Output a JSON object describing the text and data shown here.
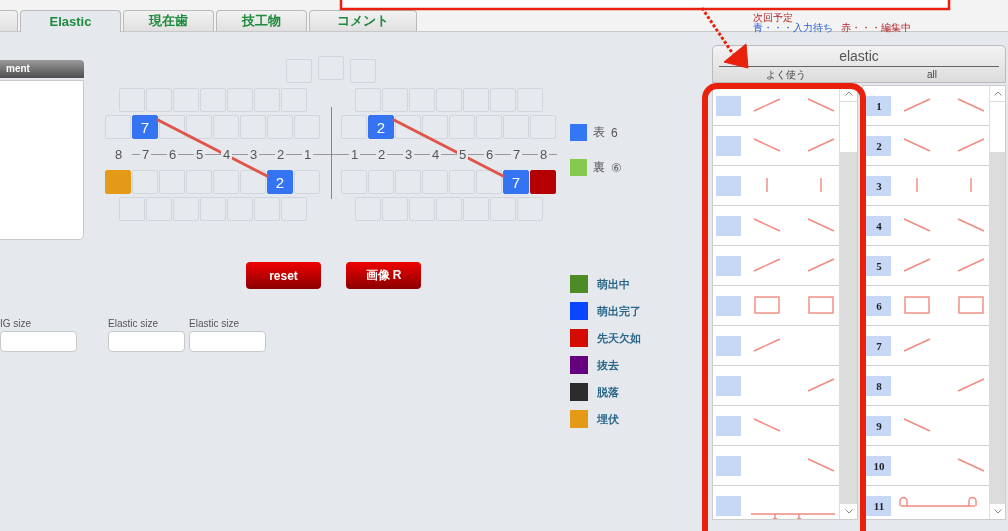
{
  "tabs": [
    {
      "selected": false
    },
    {
      "label": "Elastic",
      "selected": true
    },
    {
      "label": "現在歯",
      "selected": false
    },
    {
      "label": "技工物",
      "selected": false
    },
    {
      "label": "コメント",
      "selected": false
    }
  ],
  "schedule_note": {
    "title": "次回予定",
    "waiting": "青・・・入力待ち",
    "editing": "赤・・・編集中"
  },
  "comment_panel": {
    "title": "ment"
  },
  "chart": {
    "mini_row": [
      {
        "filled": false
      },
      {
        "filled": false
      },
      {
        "filled": false
      }
    ],
    "left": {
      "outer_upper": [
        {
          "filled": false
        },
        {
          "filled": false
        },
        {
          "filled": false
        },
        {
          "filled": false
        },
        {
          "filled": false
        },
        {
          "filled": false
        },
        {
          "filled": false
        }
      ],
      "upper": [
        {
          "filled": false
        },
        {
          "filled": true,
          "label": "7",
          "color": "#3474f2"
        },
        {
          "filled": false
        },
        {
          "filled": false
        },
        {
          "filled": false
        },
        {
          "filled": false
        },
        {
          "filled": false
        },
        {
          "filled": false
        }
      ],
      "numbers": [
        "8",
        "7",
        "6",
        "5",
        "4",
        "3",
        "2",
        "1"
      ],
      "lower": [
        {
          "filled": true,
          "color": "#e59a17"
        },
        {
          "filled": false
        },
        {
          "filled": false
        },
        {
          "filled": false
        },
        {
          "filled": false
        },
        {
          "filled": false
        },
        {
          "filled": true,
          "label": "2",
          "color": "#3474f2"
        },
        {
          "filled": false
        }
      ],
      "outer_lower": [
        {
          "filled": false
        },
        {
          "filled": false
        },
        {
          "filled": false
        },
        {
          "filled": false
        },
        {
          "filled": false
        },
        {
          "filled": false
        },
        {
          "filled": false
        }
      ]
    },
    "right": {
      "outer_upper": [
        {
          "filled": false
        },
        {
          "filled": false
        },
        {
          "filled": false
        },
        {
          "filled": false
        },
        {
          "filled": false
        },
        {
          "filled": false
        },
        {
          "filled": false
        }
      ],
      "upper": [
        {
          "filled": false
        },
        {
          "filled": true,
          "label": "2",
          "color": "#3474f2"
        },
        {
          "filled": false
        },
        {
          "filled": false
        },
        {
          "filled": false
        },
        {
          "filled": false
        },
        {
          "filled": false
        },
        {
          "filled": false
        }
      ],
      "numbers": [
        "1",
        "2",
        "3",
        "4",
        "5",
        "6",
        "7",
        "8"
      ],
      "lower": [
        {
          "filled": false
        },
        {
          "filled": false
        },
        {
          "filled": false
        },
        {
          "filled": false
        },
        {
          "filled": false
        },
        {
          "filled": false
        },
        {
          "filled": true,
          "label": "7",
          "color": "#3474f2"
        },
        {
          "filled": true,
          "color": "#b40000"
        }
      ],
      "outer_lower": [
        {
          "filled": false
        },
        {
          "filled": false
        },
        {
          "filled": false
        },
        {
          "filled": false
        },
        {
          "filled": false
        },
        {
          "filled": false
        },
        {
          "filled": false
        }
      ]
    }
  },
  "side_legend": [
    {
      "label": "表",
      "value": "6",
      "color": "#3377f5"
    },
    {
      "label": "裏",
      "value": "⑥",
      "color": "#86c94f"
    }
  ],
  "buttons": [
    "reset",
    "画像 R"
  ],
  "size_fields": [
    {
      "label": "IG size"
    },
    {
      "label": "Elastic size"
    },
    {
      "label": "Elastic size"
    }
  ],
  "status_legend": [
    {
      "label": "萌出中",
      "color": "#4e8a25"
    },
    {
      "label": "萌出完了",
      "color": "#0a46ff"
    },
    {
      "label": "先天欠如",
      "color": "#d40c00"
    },
    {
      "label": "抜去",
      "color": "#65007f"
    },
    {
      "label": "脱落",
      "color": "#2c2c2c"
    },
    {
      "label": "埋伏",
      "color": "#e59a17"
    }
  ],
  "elastic_panel": {
    "title": "elastic",
    "list_headings": [
      "よく使う",
      "all"
    ],
    "common_patterns": [
      {
        "kind": "rise-fall"
      },
      {
        "kind": "fall-rise"
      },
      {
        "kind": "bars"
      },
      {
        "kind": "fall-fall"
      },
      {
        "kind": "rise-rise"
      },
      {
        "kind": "boxes"
      },
      {
        "kind": "rise-left"
      },
      {
        "kind": "rise-right"
      },
      {
        "kind": "fall-left"
      },
      {
        "kind": "fall-right"
      },
      {
        "kind": "hooks"
      }
    ],
    "all_patterns": [
      {
        "number": "1",
        "kind": "rise-fall"
      },
      {
        "number": "2",
        "kind": "fall-rise"
      },
      {
        "number": "3",
        "kind": "bars"
      },
      {
        "number": "4",
        "kind": "fall-fall"
      },
      {
        "number": "5",
        "kind": "rise-rise"
      },
      {
        "number": "6",
        "kind": "boxes"
      },
      {
        "number": "7",
        "kind": "rise-left"
      },
      {
        "number": "8",
        "kind": "rise-right"
      },
      {
        "number": "9",
        "kind": "fall-left"
      },
      {
        "number": "10",
        "kind": "fall-right"
      },
      {
        "number": "11",
        "kind": "loops"
      }
    ]
  }
}
